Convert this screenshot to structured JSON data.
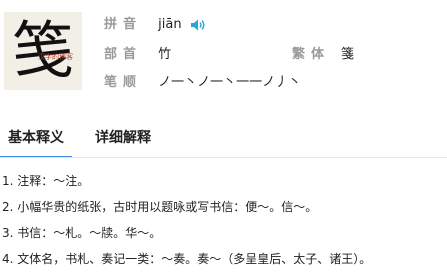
{
  "character": {
    "glyph": "笺",
    "watermark": "汉字的博客"
  },
  "info": {
    "pinyin_label": "拼音",
    "pinyin_value": "jiān",
    "radical_label": "部首",
    "radical_value": "竹",
    "traditional_label": "繁体",
    "traditional_value": "箋",
    "strokes_label": "笔顺",
    "strokes_value": "ノ一丶ノ一丶一一ノ丿丶"
  },
  "tabs": [
    {
      "label": "基本释义",
      "active": true
    },
    {
      "label": "详细解释",
      "active": false
    }
  ],
  "definitions": [
    "1. 注释：～注。",
    "2. 小幅华贵的纸张，古时用以题咏或写书信：便～。信～。",
    "3. 书信：～札。～牍。华～。",
    "4. 文体名，书札、奏记一类：～奏。奏～（多呈皇后、太子、诸王）。"
  ],
  "colors": {
    "accent": "#3a8ee6",
    "speaker": "#2aa3d6",
    "label": "#9a9a9a"
  },
  "icons": {
    "speaker": "speaker-icon"
  }
}
